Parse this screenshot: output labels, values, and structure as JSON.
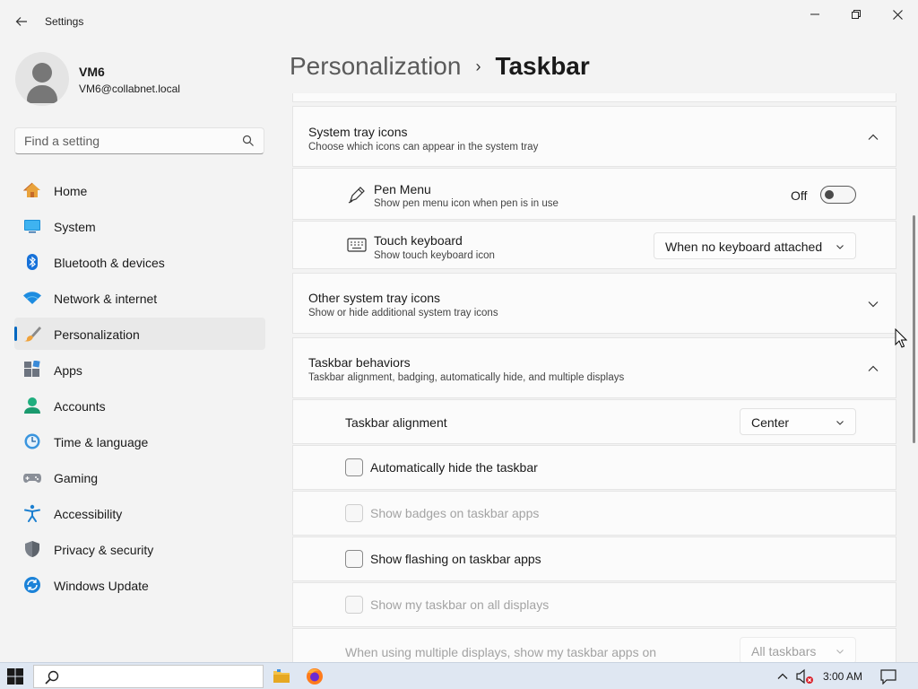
{
  "window": {
    "title": "Settings",
    "controls": {
      "minimize": "—",
      "maximize": "❐",
      "close": "✕"
    }
  },
  "user": {
    "name": "VM6",
    "email": "VM6@collabnet.local"
  },
  "search": {
    "placeholder": "Find a setting"
  },
  "sidebar": {
    "items": [
      {
        "label": "Home",
        "icon": "home-icon"
      },
      {
        "label": "System",
        "icon": "system-icon"
      },
      {
        "label": "Bluetooth & devices",
        "icon": "bluetooth-icon"
      },
      {
        "label": "Network & internet",
        "icon": "network-icon"
      },
      {
        "label": "Personalization",
        "icon": "personalization-icon",
        "active": true
      },
      {
        "label": "Apps",
        "icon": "apps-icon"
      },
      {
        "label": "Accounts",
        "icon": "accounts-icon"
      },
      {
        "label": "Time & language",
        "icon": "time-language-icon"
      },
      {
        "label": "Gaming",
        "icon": "gaming-icon"
      },
      {
        "label": "Accessibility",
        "icon": "accessibility-icon"
      },
      {
        "label": "Privacy & security",
        "icon": "privacy-icon"
      },
      {
        "label": "Windows Update",
        "icon": "windows-update-icon"
      }
    ]
  },
  "header": {
    "parent": "Personalization",
    "separator": "›",
    "current": "Taskbar"
  },
  "system_tray": {
    "title": "System tray icons",
    "subtitle": "Choose which icons can appear in the system tray",
    "pen_menu": {
      "title": "Pen Menu",
      "subtitle": "Show pen menu icon when pen is in use",
      "state_label": "Off"
    },
    "touch_keyboard": {
      "title": "Touch keyboard",
      "subtitle": "Show touch keyboard icon",
      "value": "When no keyboard attached"
    }
  },
  "other_tray": {
    "title": "Other system tray icons",
    "subtitle": "Show or hide additional system tray icons"
  },
  "behaviors": {
    "title": "Taskbar behaviors",
    "subtitle": "Taskbar alignment, badging, automatically hide, and multiple displays",
    "alignment": {
      "label": "Taskbar alignment",
      "value": "Center"
    },
    "auto_hide": {
      "label": "Automatically hide the taskbar",
      "checked": false
    },
    "badges": {
      "label": "Show badges on taskbar apps",
      "checked": false,
      "disabled": true
    },
    "flashing": {
      "label": "Show flashing on taskbar apps",
      "checked": false
    },
    "all_displays": {
      "label": "Show my taskbar on all displays",
      "checked": false,
      "disabled": true
    },
    "multi_display": {
      "label": "When using multiple displays, show my taskbar apps on",
      "value": "All taskbars"
    }
  },
  "taskbar": {
    "time": "3:00 AM"
  },
  "colors": {
    "accent": "#0067c0",
    "background": "#f3f3f3",
    "card": "#fbfbfb",
    "taskbar": "#dfe7f2"
  }
}
